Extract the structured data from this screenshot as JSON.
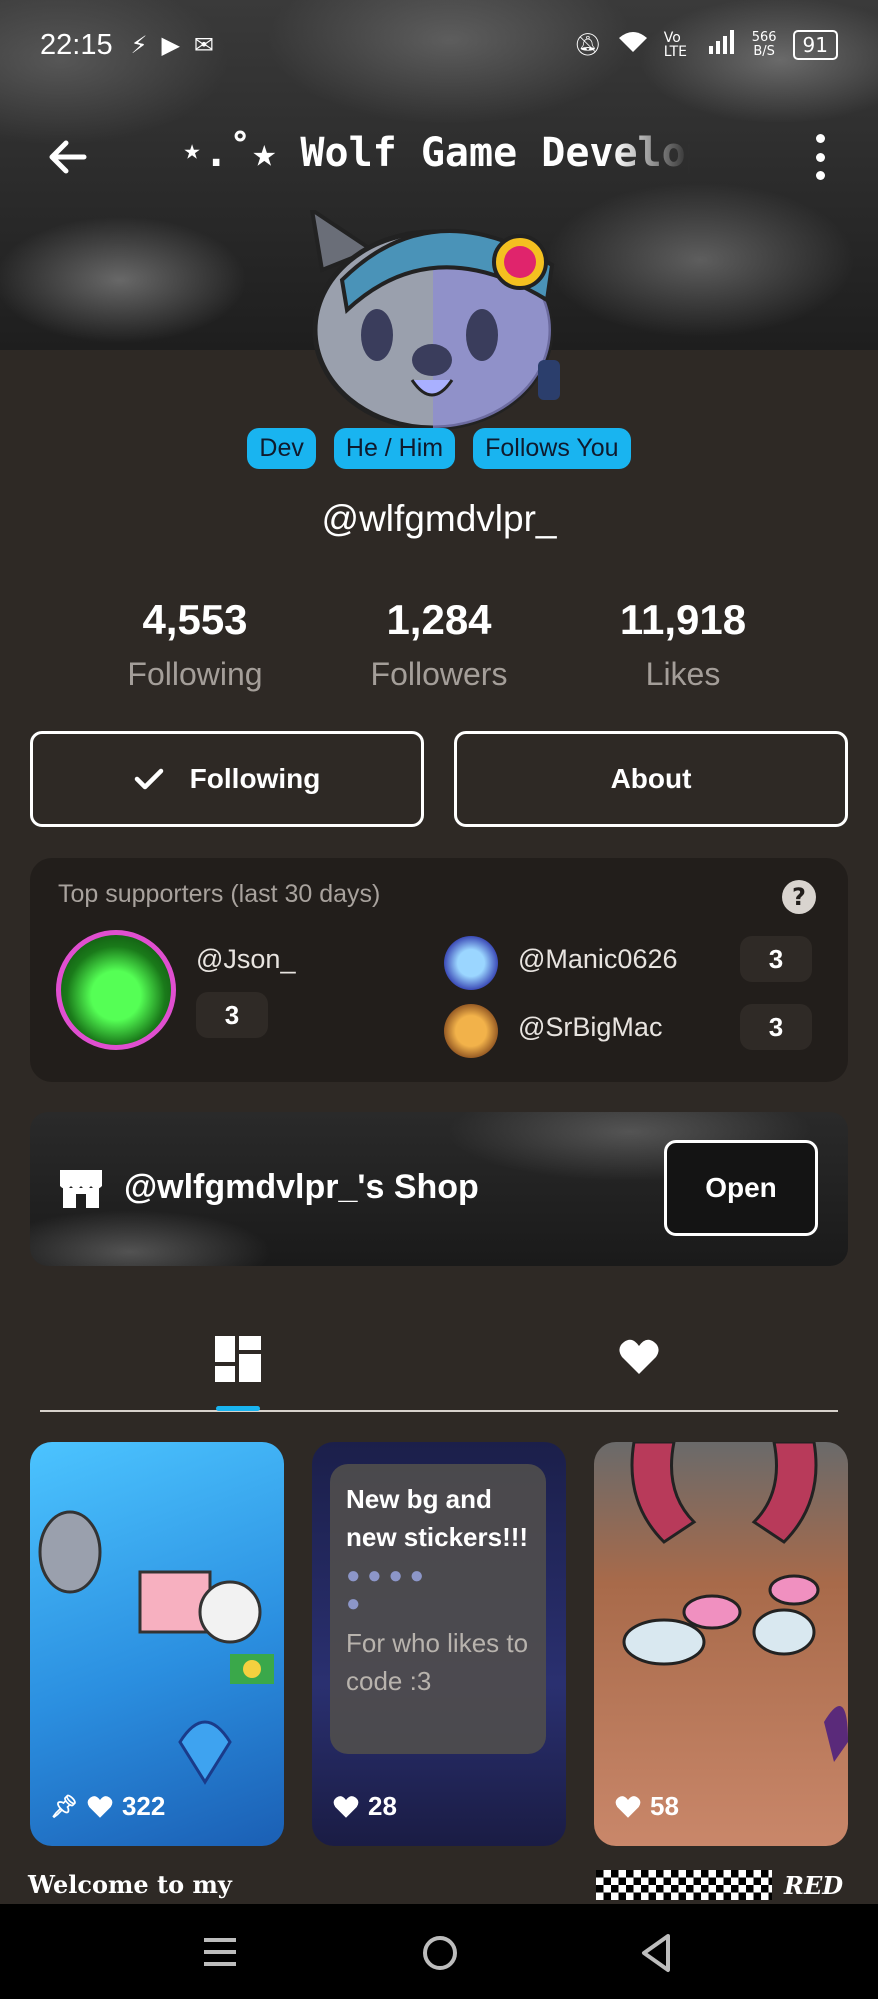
{
  "status": {
    "time": "22:15",
    "network_speed": "566 B/S",
    "net_top": "566",
    "net_bottom": "B/S",
    "volte": "Vo LTE",
    "battery": "91"
  },
  "header": {
    "title": "⋆.˚★ Wolf Game Developer"
  },
  "profile": {
    "badges": [
      "Dev",
      "He / Him",
      "Follows You"
    ],
    "username": "@wlfgmdvlpr_",
    "stats": [
      {
        "value": "4,553",
        "label": "Following"
      },
      {
        "value": "1,284",
        "label": "Followers"
      },
      {
        "value": "11,918",
        "label": "Likes"
      }
    ],
    "following_label": "Following",
    "about_label": "About"
  },
  "supporters": {
    "title": "Top supporters (last 30 days)",
    "top": {
      "name": "@Json_",
      "count": "3"
    },
    "others": [
      {
        "name": "@Manic0626",
        "count": "3"
      },
      {
        "name": "@SrBigMac",
        "count": "3"
      }
    ]
  },
  "shop": {
    "title": "@wlfgmdvlpr_'s Shop",
    "open_label": "Open"
  },
  "posts": [
    {
      "likes": "322"
    },
    {
      "likes": "28",
      "text": "New bg and new stickers!!!",
      "subtext": "For who likes to code :3"
    },
    {
      "likes": "58"
    }
  ],
  "captions": {
    "left": "Welcome to my",
    "right": "RED"
  },
  "colors": {
    "accent": "#19b4f0",
    "background": "#2e2925"
  }
}
